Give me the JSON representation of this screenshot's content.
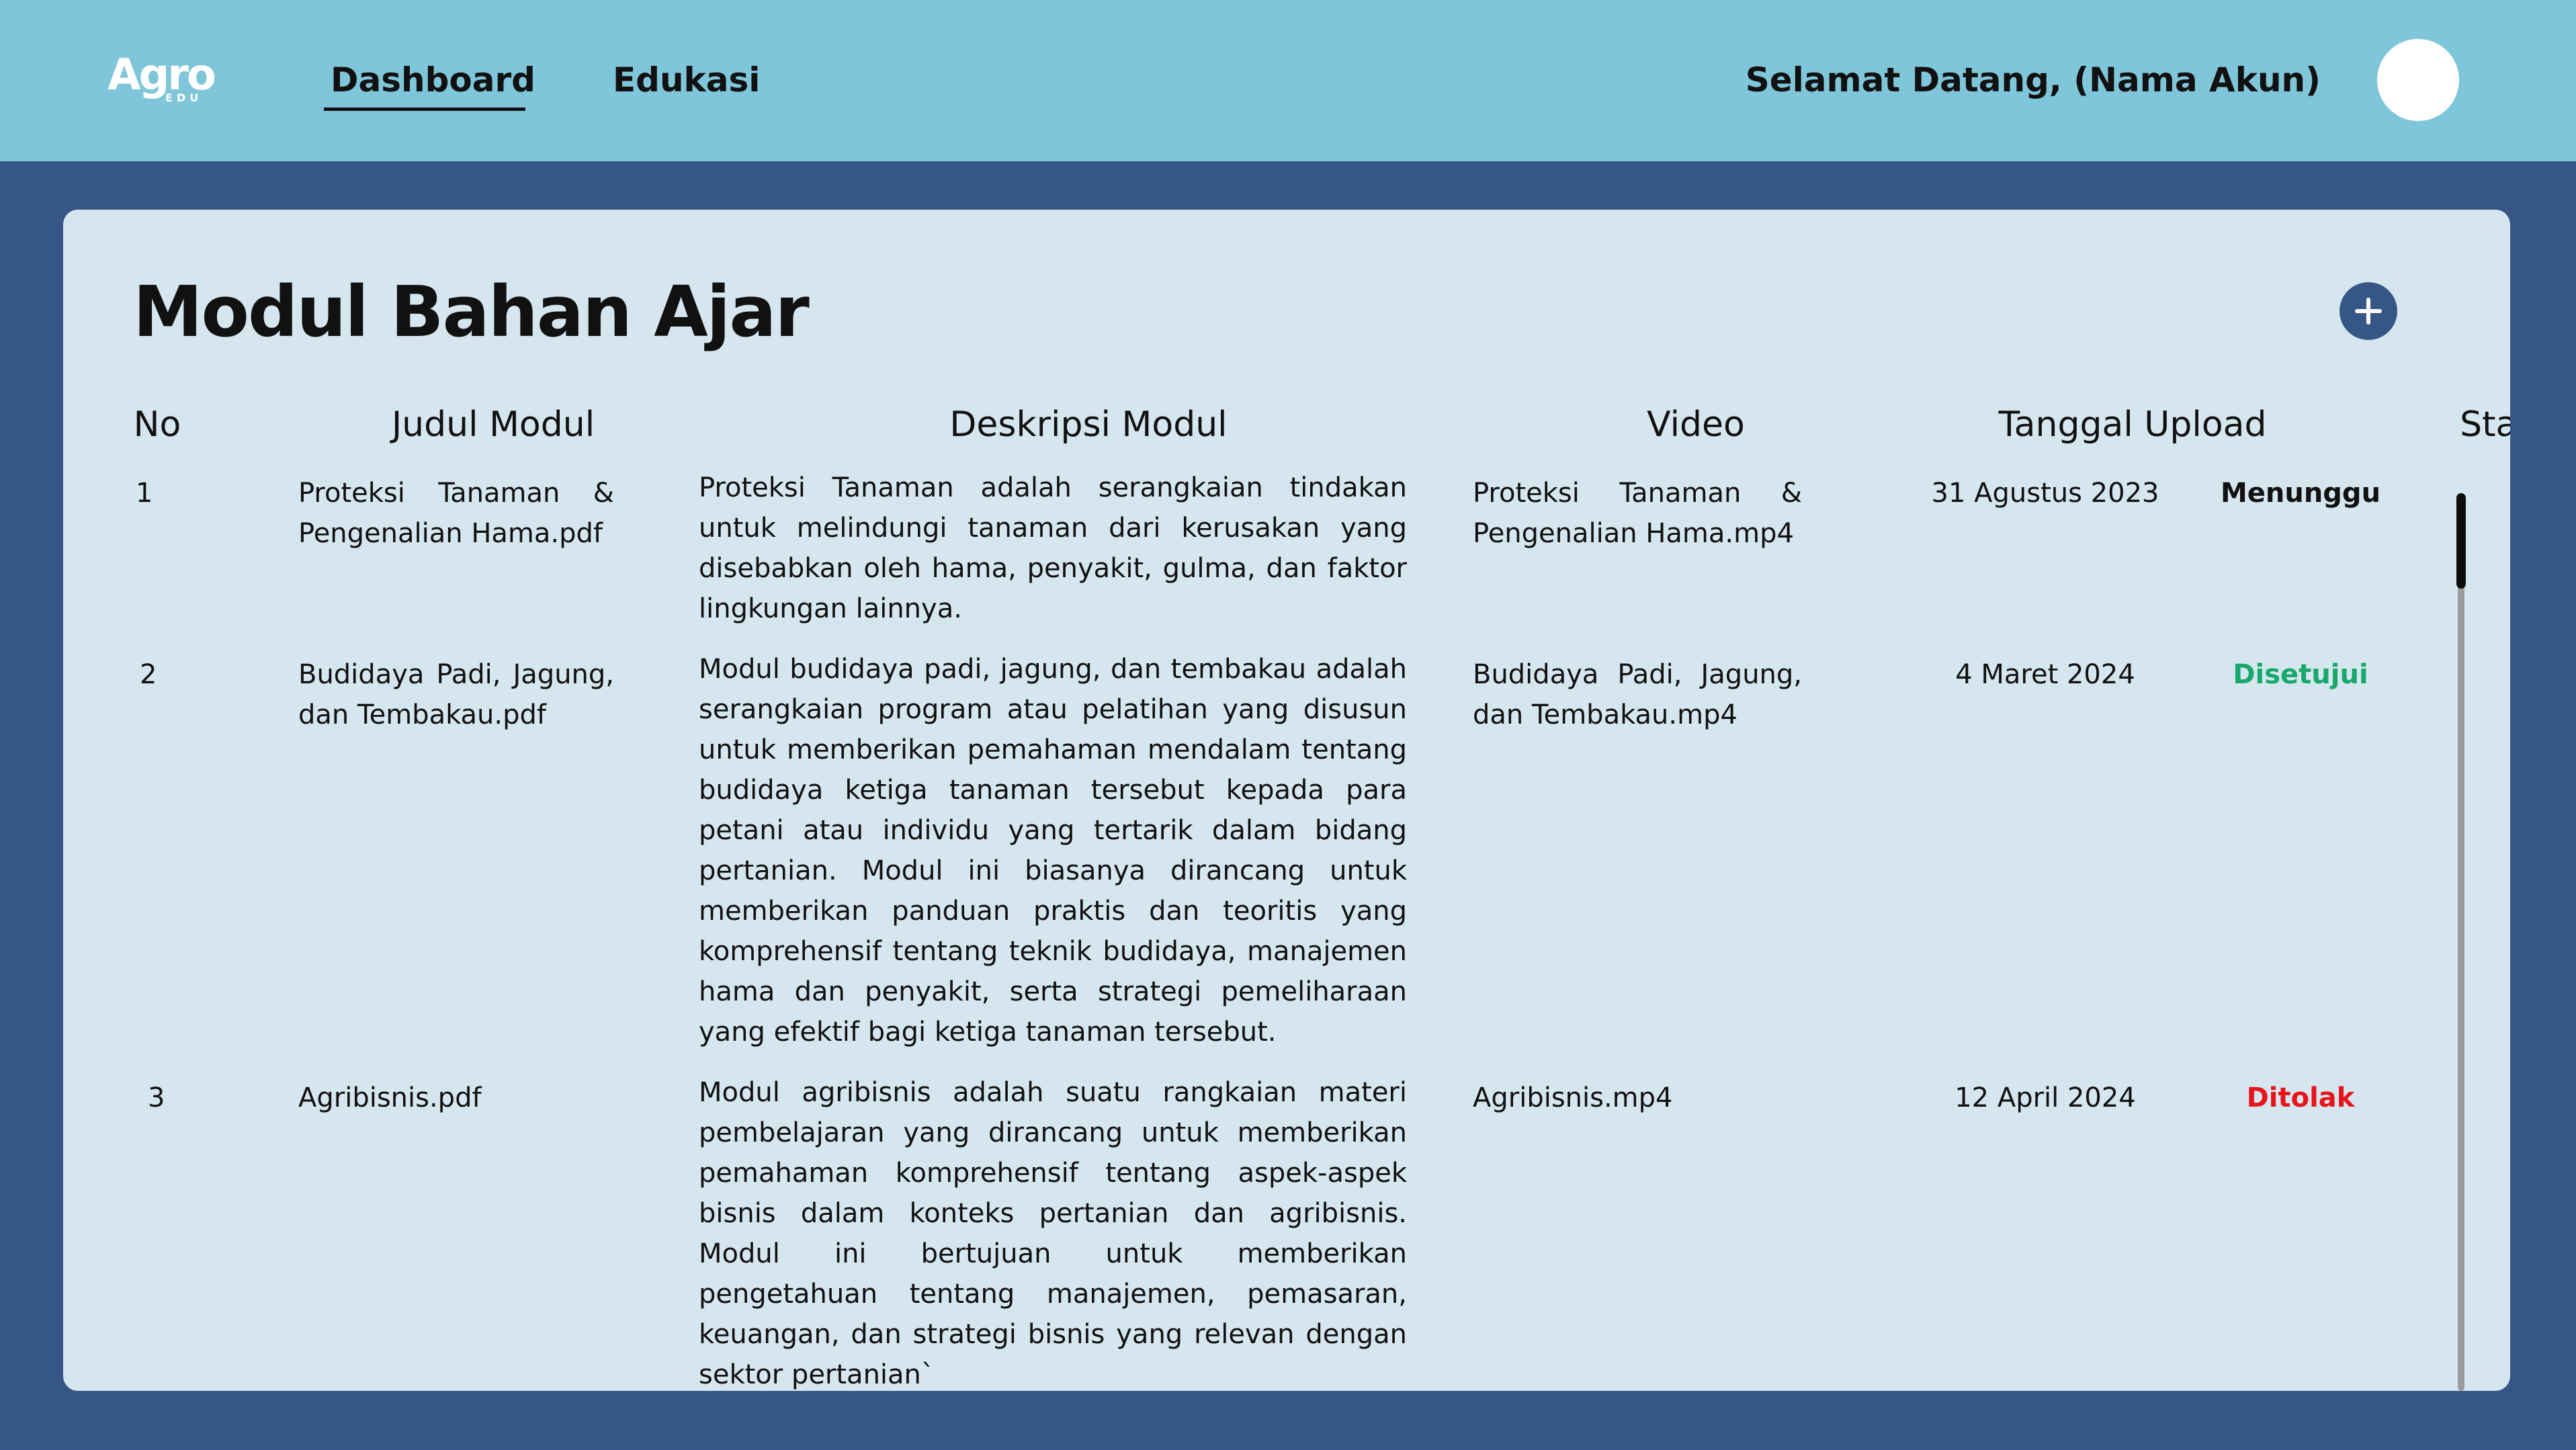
{
  "brand": {
    "logo_text": "Agro",
    "logo_sub": "EDU"
  },
  "nav": {
    "items": [
      {
        "label": "Dashboard",
        "active": true
      },
      {
        "label": "Edukasi",
        "active": false
      }
    ],
    "greeting": "Selamat Datang, (Nama Akun)"
  },
  "page": {
    "title": "Modul Bahan Ajar",
    "add_icon": "plus-icon"
  },
  "table": {
    "headers": {
      "no": "No",
      "judul": "Judul Modul",
      "deskripsi": "Deskripsi Modul",
      "video": "Video",
      "tanggal": "Tanggal Upload",
      "status": "Status"
    },
    "rows": [
      {
        "no": "1",
        "judul": "Proteksi Tanaman & Pengenalian Hama.pdf",
        "deskripsi": "Proteksi Tanaman adalah serangkaian tindakan untuk melindungi tanaman dari kerusakan yang disebabkan oleh hama, penyakit, gulma, dan faktor lingkungan lainnya.",
        "video": "Proteksi Tanaman & Pengenalian Hama.mp4",
        "tanggal": "31 Agustus 2023",
        "status": "Menunggu",
        "status_color": "#111111"
      },
      {
        "no": "2",
        "judul": "Budidaya Padi, Jagung, dan Tembakau.pdf",
        "deskripsi": "Modul budidaya padi, jagung, dan tembakau adalah serangkaian program atau pelatihan yang disusun untuk memberikan pemahaman mendalam tentang budidaya ketiga tanaman tersebut kepada para petani atau individu yang tertarik dalam bidang pertanian. Modul ini biasanya dirancang untuk memberikan panduan praktis dan teoritis yang komprehensif tentang teknik budidaya, manajemen hama dan penyakit, serta strategi pemeliharaan yang efektif bagi ketiga tanaman tersebut.",
        "video": "Budidaya Padi, Jagung, dan Tembakau.mp4",
        "tanggal": "4 Maret 2024",
        "status": "Disetujui",
        "status_color": "#17a86b"
      },
      {
        "no": "3",
        "judul": "Agribisnis.pdf",
        "deskripsi": "Modul agribisnis adalah suatu rangkaian materi pembelajaran yang dirancang untuk memberikan pemahaman komprehensif tentang aspek-aspek bisnis dalam konteks pertanian dan agribisnis. Modul ini bertujuan untuk memberikan pengetahuan tentang manajemen, pemasaran, keuangan, dan strategi bisnis yang relevan dengan sektor pertanian`",
        "video": "Agribisnis.mp4",
        "tanggal": "12 April 2024",
        "status": "Ditolak",
        "status_color": "#e8141b"
      }
    ]
  },
  "colors": {
    "topbar": "#7fc6da",
    "background": "#355687",
    "card": "#d6e6ee",
    "accent": "#355687"
  }
}
